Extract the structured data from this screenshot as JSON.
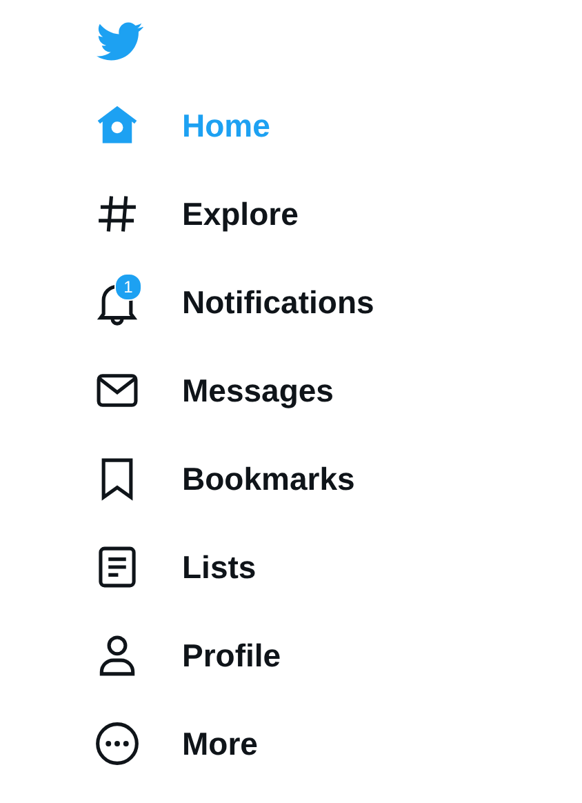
{
  "nav": {
    "items": [
      {
        "label": "Home",
        "selected": true
      },
      {
        "label": "Explore",
        "selected": false
      },
      {
        "label": "Notifications",
        "selected": false,
        "badge": "1"
      },
      {
        "label": "Messages",
        "selected": false
      },
      {
        "label": "Bookmarks",
        "selected": false
      },
      {
        "label": "Lists",
        "selected": false
      },
      {
        "label": "Profile",
        "selected": false
      },
      {
        "label": "More",
        "selected": false
      }
    ]
  }
}
